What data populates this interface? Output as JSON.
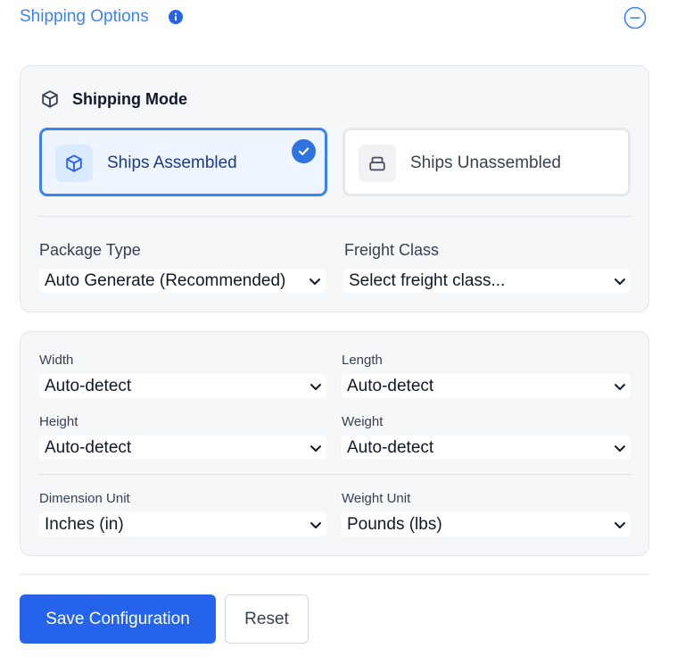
{
  "header": {
    "title": "Shipping Options",
    "info_icon": "info-icon",
    "collapse_icon": "minus-circle-icon",
    "accent_color": "#3b82f6"
  },
  "shipping_mode": {
    "title": "Shipping Mode",
    "icon": "box-icon",
    "options": [
      {
        "label": "Ships Assembled",
        "icon": "box-icon",
        "selected": true
      },
      {
        "label": "Ships Unassembled",
        "icon": "stacked-boxes-icon",
        "selected": false
      }
    ]
  },
  "package": {
    "package_type_label": "Package Type",
    "package_type_value": "Auto Generate (Recommended)",
    "freight_class_label": "Freight Class",
    "freight_class_value": "Select freight class..."
  },
  "dimensions": {
    "width_label": "Width",
    "width_value": "Auto-detect",
    "length_label": "Length",
    "length_value": "Auto-detect",
    "height_label": "Height",
    "height_value": "Auto-detect",
    "weight_label": "Weight",
    "weight_value": "Auto-detect",
    "dimension_unit_label": "Dimension Unit",
    "dimension_unit_value": "Inches (in)",
    "weight_unit_label": "Weight Unit",
    "weight_unit_value": "Pounds (lbs)"
  },
  "actions": {
    "save_label": "Save Configuration",
    "reset_label": "Reset",
    "primary_color": "#2563eb"
  }
}
